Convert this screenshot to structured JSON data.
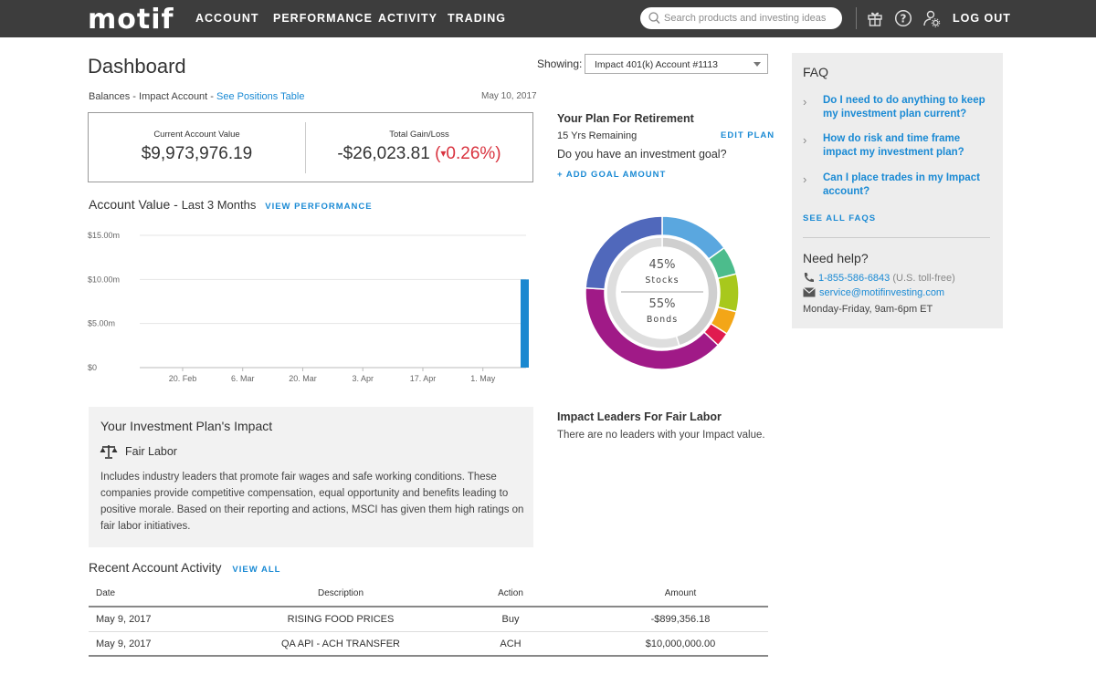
{
  "nav": {
    "logo": "motif",
    "items": [
      "ACCOUNT",
      "PERFORMANCE",
      "ACTIVITY",
      "TRADING"
    ],
    "search_placeholder": "Search products and investing ideas",
    "icons": [
      "gift-icon",
      "help-icon",
      "user-settings-icon"
    ],
    "logout": "LOG OUT"
  },
  "dashboard": {
    "title": "Dashboard",
    "showing_label": "Showing:",
    "account_selected": "Impact 401(k) Account #1113",
    "balances_prefix": "Balances - Impact Account - ",
    "balances_link": "See Positions Table",
    "date": "May 10, 2017",
    "current_value_label": "Current Account Value",
    "current_value": "$9,973,976.19",
    "gain_label": "Total Gain/Loss",
    "gain_value": "-$26,023.81",
    "gain_pct": "0.26%",
    "gain_pct_open": "(",
    "gain_pct_close": ")",
    "gain_arrow": "▾"
  },
  "account_chart": {
    "title": "Account Value - ",
    "subtitle": "Last 3 Months",
    "link": "VIEW PERFORMANCE"
  },
  "chart_data": {
    "type": "bar",
    "title": "",
    "x_ticks": [
      "20. Feb",
      "6. Mar",
      "20. Mar",
      "3. Apr",
      "17. Apr",
      "1. May"
    ],
    "y_ticks": [
      "$0",
      "$5.00m",
      "$10.00m",
      "$15.00m"
    ],
    "ylim": [
      0,
      15000000
    ],
    "x_range": [
      "2017-02-10",
      "2017-05-10"
    ],
    "bars": [
      {
        "x": "2017-05-10",
        "value": 10000000
      }
    ],
    "bar_color": "#1a88d0",
    "grid": true
  },
  "retirement": {
    "title": "Your Plan For Retirement",
    "edit_link": "EDIT PLAN",
    "years": "15 Yrs Remaining",
    "question": "Do you have an investment goal?",
    "add_goal": "+ ADD GOAL AMOUNT"
  },
  "allocation": {
    "stocks_pct": "45%",
    "stocks_label": "Stocks",
    "bonds_pct": "55%",
    "bonds_label": "Bonds",
    "stocks_share": 45,
    "bonds_share": 55,
    "outer_segments": [
      {
        "value": 15,
        "color": "#5aa7df"
      },
      {
        "value": 6,
        "color": "#4cbc8c"
      },
      {
        "value": 8,
        "color": "#a8c81c"
      },
      {
        "value": 5,
        "color": "#f3a617"
      },
      {
        "value": 3,
        "color": "#e01b4f"
      },
      {
        "value": 39,
        "color": "#a01a87"
      },
      {
        "value": 24,
        "color": "#5068bb"
      }
    ],
    "inner_stocks_color": "#cfcfcf",
    "inner_bonds_color": "#dedede"
  },
  "impact": {
    "title": "Your Investment Plan's Impact",
    "icon": "scales-icon",
    "category": "Fair Labor",
    "description": "Includes industry leaders that promote fair wages and safe working conditions. These companies provide competitive compensation, equal opportunity and benefits leading to positive morale. Based on their reporting and actions, MSCI has given them high ratings on fair labor initiatives."
  },
  "leaders": {
    "title": "Impact Leaders For Fair Labor",
    "text": "There are no leaders with your Impact value."
  },
  "activity": {
    "title": "Recent Account Activity",
    "link": "VIEW ALL",
    "columns": [
      "Date",
      "Description",
      "Action",
      "Amount"
    ],
    "rows": [
      [
        "May 9, 2017",
        "RISING FOOD PRICES",
        "Buy",
        "-$899,356.18"
      ],
      [
        "May 9, 2017",
        "QA API - ACH TRANSFER",
        "ACH",
        "$10,000,000.00"
      ]
    ]
  },
  "faq": {
    "title": "FAQ",
    "questions": [
      "Do I need to do anything to keep my investment plan current?",
      "How do risk and time frame impact my investment plan?",
      "Can I place trades in my Impact account?"
    ],
    "see_all": "SEE ALL FAQS",
    "help_title": "Need help?",
    "phone": "1-855-586-6843",
    "phone_note": " (U.S. toll-free)",
    "email": "service@motifinvesting.com",
    "hours": "Monday-Friday, 9am-6pm ET"
  }
}
